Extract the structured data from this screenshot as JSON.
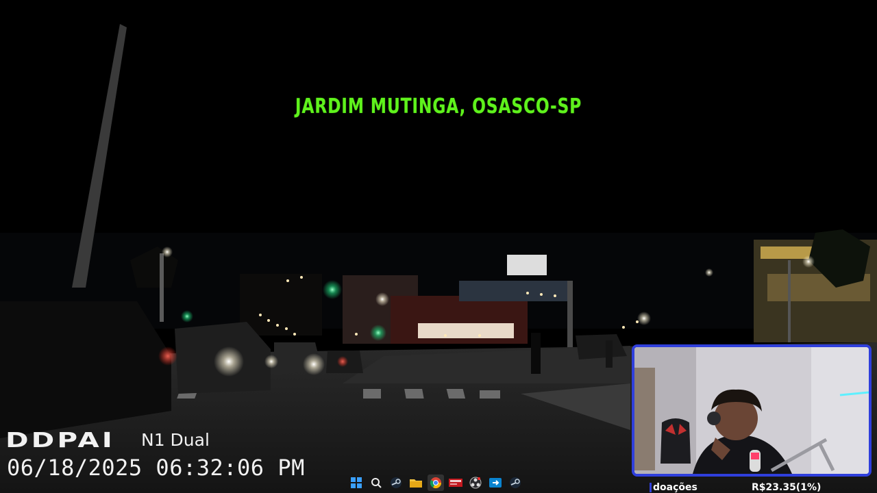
{
  "overlay": {
    "location_title": "JARDIM MUTINGA, OSASCO-SP"
  },
  "dashcam": {
    "brand": "DDPAI",
    "model": "N1 Dual",
    "timestamp": "06/18/2025 06:32:06 PM"
  },
  "stream": {
    "donations_label": "doações",
    "donations_amount": "R$23.35(1%)"
  },
  "taskbar": {
    "icons": [
      "windows-start-icon",
      "search-icon",
      "steam-icon",
      "file-explorer-icon",
      "chrome-icon",
      "streamlabs-icon",
      "obs-icon",
      "remote-desktop-icon",
      "steam-icon"
    ]
  },
  "colors": {
    "title_green": "#5ff21c",
    "webcam_border": "#2f3fdc"
  }
}
